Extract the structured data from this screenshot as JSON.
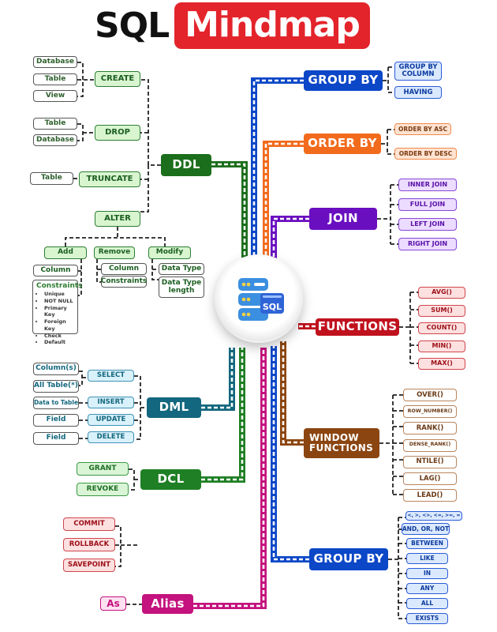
{
  "title": {
    "part1": "SQL",
    "part2": "Mindmap"
  },
  "hub": {
    "icon_label": "SQL"
  },
  "colors": {
    "ddl": "#1b6e1b",
    "group_by": "#0b47c7",
    "order_by": "#f26b1d",
    "join": "#6a0fc0",
    "functions": "#c0121e",
    "window_functions": "#8b4510",
    "dml": "#13677e",
    "dcl_grant": "#1f7f24",
    "dcl_commit": "#a80f12",
    "alias": "#c4127e",
    "filter": "#0b47c7",
    "title_red": "#e3242b"
  },
  "ddl": {
    "label": "DDL",
    "create": {
      "label": "CREATE",
      "items": [
        "Database",
        "Table",
        "View"
      ]
    },
    "drop": {
      "label": "DROP",
      "items": [
        "Table",
        "Database"
      ]
    },
    "truncate": {
      "label": "TRUNCATE",
      "items": [
        "Table"
      ]
    },
    "alter": {
      "label": "ALTER",
      "add": {
        "label": "Add",
        "column": "Column",
        "constraints_title": "Constraints",
        "constraints": [
          "Unique",
          "NOT NULL",
          "Primary Key",
          "Foreign Key",
          "Check",
          "Default"
        ]
      },
      "remove": {
        "label": "Remove",
        "items": [
          "Column",
          "Constraints"
        ]
      },
      "modify": {
        "label": "Modify",
        "items": [
          "Data Type",
          "Data Type length"
        ]
      }
    }
  },
  "group_by_top": {
    "label": "GROUP BY",
    "items": [
      "GROUP BY COLUMN",
      "HAVING"
    ]
  },
  "order_by": {
    "label": "ORDER BY",
    "items": [
      "ORDER BY ASC",
      "ORDER BY DESC"
    ]
  },
  "join": {
    "label": "JOIN",
    "items": [
      "INNER JOIN",
      "FULL JOIN",
      "LEFT JOIN",
      "RIGHT JOIN"
    ]
  },
  "functions": {
    "label": "FUNCTIONS",
    "items": [
      "AVG()",
      "SUM()",
      "COUNT()",
      "MIN()",
      "MAX()"
    ]
  },
  "window_functions": {
    "label": "WINDOW FUNCTIONS",
    "items": [
      "OVER()",
      "ROW_NUMBER()",
      "RANK()",
      "DENSE_RANK()",
      "NTILE()",
      "LAG()",
      "LEAD()"
    ]
  },
  "group_by_bottom": {
    "label": "GROUP BY",
    "items": [
      "<, >, <>, <=, >=, =",
      "AND, OR, NOT",
      "BETWEEN",
      "LIKE",
      "IN",
      "ANY",
      "ALL",
      "EXISTS"
    ]
  },
  "dml": {
    "label": "DML",
    "commands": [
      {
        "label": "SELECT",
        "targets": [
          "Column(s)",
          "All Table(*)"
        ]
      },
      {
        "label": "INSERT",
        "targets": [
          "Data to Table"
        ]
      },
      {
        "label": "UPDATE",
        "targets": [
          "Field"
        ]
      },
      {
        "label": "DELETE",
        "targets": [
          "Field"
        ]
      }
    ]
  },
  "dcl_access": {
    "label": "DCL",
    "items": [
      "GRANT",
      "REVOKE"
    ]
  },
  "dcl_transaction": {
    "label": "DCL",
    "items": [
      "COMMIT",
      "ROLLBACK",
      "SAVEPOINT"
    ]
  },
  "alias": {
    "label": "Alias",
    "items": [
      "As"
    ]
  }
}
